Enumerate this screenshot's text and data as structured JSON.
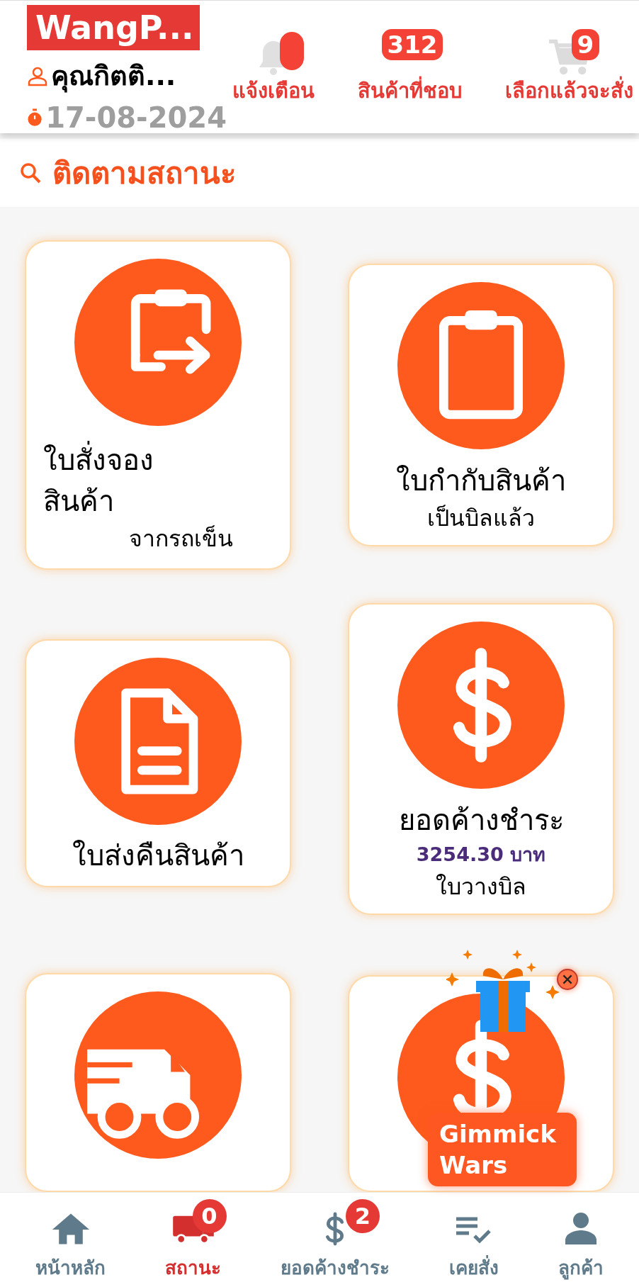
{
  "header": {
    "title": "WangP...",
    "user": "คุณกิตติ...",
    "date": "17-08-2024",
    "shortcuts": [
      {
        "kind": "bell",
        "label": "แจ้งเตือน"
      },
      {
        "kind": "favorites",
        "label": "สินค้าที่ชอบ",
        "badge": "312"
      },
      {
        "kind": "cart",
        "label": "เลือกแล้วจะสั่ง",
        "badge": "9"
      }
    ]
  },
  "section_title": "ติดตามสถานะ",
  "columns": [
    [
      {
        "kind": "clipboard-arrow",
        "title": "ใบสั่งจอง\nสินค้า",
        "subtitle": "จากรถเข็น"
      },
      {
        "kind": "document",
        "title": "ใบส่งคืนสินค้า"
      },
      {
        "kind": "truck"
      }
    ],
    [
      {
        "kind": "clipboard",
        "title": "ใบกำกับสินค้า",
        "subtitle": "เป็นบิลแล้ว"
      },
      {
        "kind": "dollar",
        "title": "ยอดค้างชำระ",
        "amount": "3254.30 บาท",
        "subtitle": "ใบวางบิล"
      },
      {
        "kind": "dollar"
      }
    ]
  ],
  "promo": {
    "label": "Gimmick Wars"
  },
  "nav": [
    {
      "kind": "home",
      "label": "หน้าหลัก",
      "selected": false
    },
    {
      "kind": "truck",
      "label": "สถานะ",
      "selected": true,
      "badge": "0"
    },
    {
      "kind": "dollar",
      "label": "ยอดค้างชำระ",
      "selected": false,
      "badge": "2"
    },
    {
      "kind": "list",
      "label": "เคยสั่ง",
      "selected": false
    },
    {
      "kind": "person",
      "label": "ลูกค้า",
      "selected": false
    }
  ]
}
